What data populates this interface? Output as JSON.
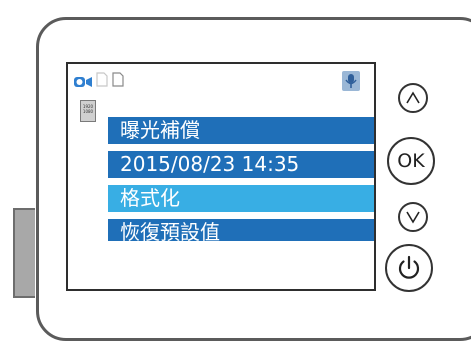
{
  "status_bar": {
    "camera_icon": "video-camera-icon",
    "card_icon_1": "sd-card-icon",
    "card_icon_2": "sd-card-icon",
    "mic_icon": "microphone-icon",
    "resolution_badge_lines": [
      "1920",
      "1080"
    ]
  },
  "menu": {
    "items": [
      {
        "label": "曝光補償",
        "selected": false
      },
      {
        "label": "2015/08/23  14:35",
        "selected": false
      },
      {
        "label": "格式化",
        "selected": true
      },
      {
        "label": "恢復預設值",
        "selected": false
      }
    ]
  },
  "buttons": {
    "up_glyph": "Λ",
    "ok_label": "OK",
    "down_glyph": "V",
    "power_icon": "power-icon"
  },
  "colors": {
    "item_normal": "#1f6fb8",
    "item_selected": "#38aee4",
    "camera_icon": "#2f7fd0"
  }
}
